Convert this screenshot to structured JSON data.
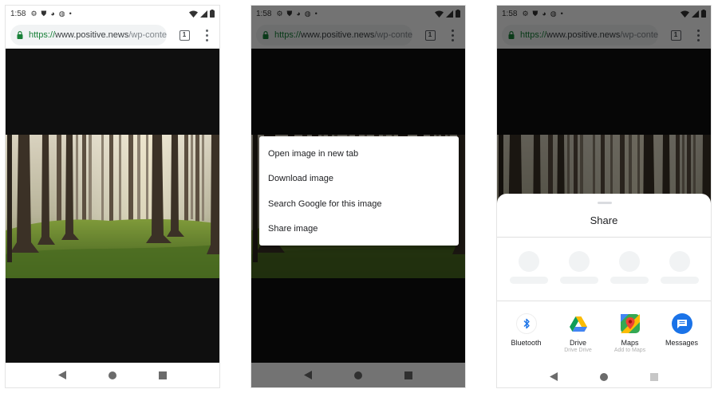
{
  "status_bar": {
    "time": "1:58"
  },
  "browser": {
    "url_scheme": "https://",
    "url_rest": "www.positive.news",
    "url_tail": "/wp-conte",
    "tab_count": "1"
  },
  "context_menu": {
    "items": [
      "Open image in new tab",
      "Download image",
      "Search Google for this image",
      "Share image"
    ]
  },
  "share_sheet": {
    "title": "Share",
    "apps": [
      {
        "label": "Bluetooth",
        "sub": ""
      },
      {
        "label": "Drive",
        "sub": "Drive Drive"
      },
      {
        "label": "Maps",
        "sub": "Add to Maps"
      },
      {
        "label": "Messages",
        "sub": ""
      }
    ]
  },
  "icons": [
    "gear-icon",
    "shield-icon",
    "circle-icon",
    "globe-icon",
    "wifi-icon",
    "signal-icon",
    "battery-icon",
    "lock-icon",
    "tab-switcher-icon",
    "overflow-menu-icon",
    "back-icon",
    "home-icon",
    "recents-icon",
    "bluetooth-icon",
    "drive-icon",
    "maps-icon",
    "messages-icon"
  ],
  "colors": {
    "url_scheme_green": "#188038",
    "dark_background": "#0f0f0f",
    "bluetooth_blue": "#1a73e8",
    "messages_blue": "#1a73e8"
  }
}
